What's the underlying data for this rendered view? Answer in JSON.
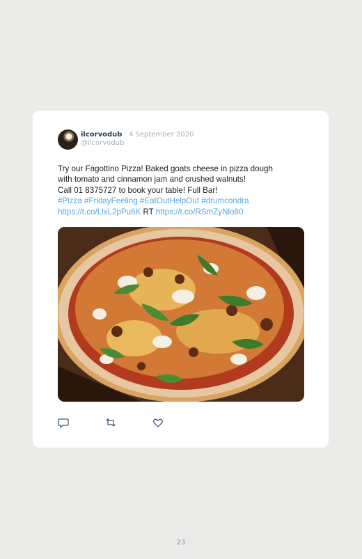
{
  "tweet": {
    "username": "ilcorvodub",
    "separator": "·",
    "date": "4 September 2020",
    "handle": "@ilcorvodub",
    "text_lines": [
      "Try our Fagottino Pizza! Baked goats cheese in pizza dough",
      "with tomato and cinnamon jam and crushed walnuts!",
      "Call 01 8375727 to book your table! Full Bar!"
    ],
    "hashtags": "#Pizza #FridayFeeling #EatOutHelpOut #drumcondra",
    "link1": "https://t.co/LlxL2pPu6K",
    "rt_label": "RT",
    "link2": "https://t.co/RSmZyNlo80",
    "image": {
      "subject": "pizza-photo"
    },
    "actions": [
      {
        "icon": "reply-icon"
      },
      {
        "icon": "retweet-icon"
      },
      {
        "icon": "like-icon"
      }
    ],
    "colors": {
      "username": "#2f3e55",
      "link": "#5aa6db",
      "meta": "#a7b0bb"
    }
  },
  "page": {
    "number": "23"
  }
}
